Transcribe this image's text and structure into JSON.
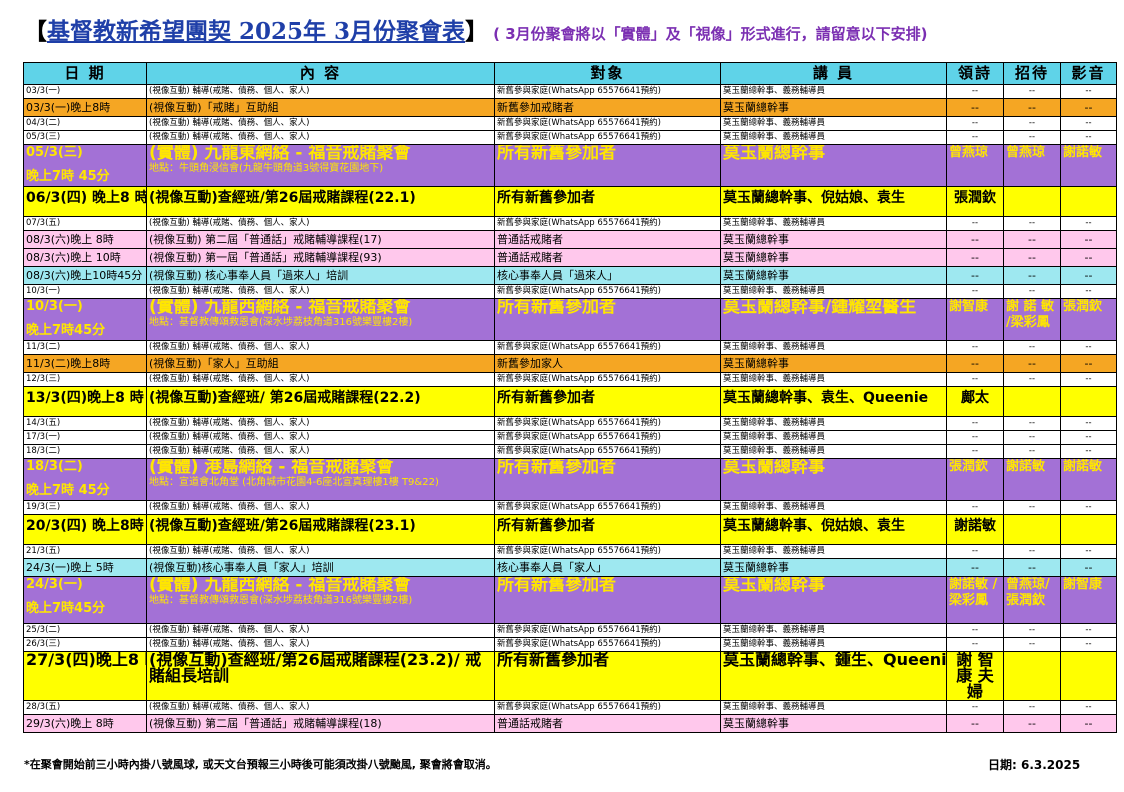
{
  "title": {
    "bracket_open": "【",
    "main": "基督教新希望團契 2025年 3月份聚會表",
    "bracket_close": "】",
    "subtitle": "( 3月份聚會將以「實體」及「視像」形式進行，請留意以下安排)"
  },
  "headers": [
    "日 期",
    "內 容",
    "對象",
    "講 員",
    "領詩",
    "招待",
    "影音"
  ],
  "rows": [
    {
      "cls": "r-m bg-white",
      "date": "03/3(一)",
      "content": "(視像互動) 輔導(戒賭、債務、個人、家人)",
      "target": "新舊參與家庭(WhatsApp 65576641預約)",
      "speaker": "莫玉蘭總幹事、義務輔導員",
      "lead": "--",
      "usher": "--",
      "av": "--"
    },
    {
      "cls": "r-s bg-orange",
      "date": "03/3(一)晚上8時",
      "content": "(視像互動)「戒賭」互助組",
      "target": "新舊參加戒賭者",
      "speaker": "莫玉蘭總幹事",
      "lead": "--",
      "usher": "--",
      "av": "--"
    },
    {
      "cls": "r-m bg-white",
      "date": "04/3(二)",
      "content": "(視像互動) 輔導(戒賭、債務、個人、家人)",
      "target": "新舊參與家庭(WhatsApp 65576641預約)",
      "speaker": "莫玉蘭總幹事、義務輔導員",
      "lead": "--",
      "usher": "--",
      "av": "--"
    },
    {
      "cls": "r-m bg-white",
      "date": "05/3(三)",
      "content": "(視像互動) 輔導(戒賭、債務、個人、家人)",
      "target": "新舊參與家庭(WhatsApp 65576641預約)",
      "speaker": "莫玉蘭總幹事、義務輔導員",
      "lead": "--",
      "usher": "--",
      "av": "--"
    },
    {
      "cls": "r-xl bg-purple",
      "date": "05/3(三)",
      "date2": "晚上7時 45分",
      "content": "(實體) 九龍東網絡 - 福音戒賭聚會",
      "loc": "地點：牛頭角浸信會(九龍牛頭角道3號得寶花園地下)",
      "target": "所有新舊參加者",
      "speaker": "莫玉蘭總幹事",
      "lead": "曾燕琼",
      "usher": "曾燕琼",
      "av": "謝諾敏"
    },
    {
      "cls": "r-l bg-yellow",
      "date": "06/3(四) 晚上8 時",
      "content": "(視像互動)查經班/第26屆戒賭課程(22.1)",
      "target": "所有新舊參加者",
      "speaker": "莫玉蘭總幹事、倪姑娘、袁生",
      "lead": "張潤欽",
      "usher": "",
      "av": ""
    },
    {
      "cls": "r-m bg-white",
      "date": "07/3(五)",
      "content": "(視像互動) 輔導(戒賭、債務、個人、家人)",
      "target": "新舊參與家庭(WhatsApp 65576641預約)",
      "speaker": "莫玉蘭總幹事、義務輔導員",
      "lead": "--",
      "usher": "--",
      "av": "--"
    },
    {
      "cls": "r-s bg-pink",
      "date": "08/3(六)晚上 8時",
      "content": "(視像互動) 第二屆「普通話」戒賭輔導課程(17)",
      "target": "普通話戒賭者",
      "speaker": "莫玉蘭總幹事",
      "lead": "--",
      "usher": "--",
      "av": "--"
    },
    {
      "cls": "r-s bg-pink",
      "date": "08/3(六)晚上 10時",
      "content": "(視像互動) 第一屆「普通話」戒賭輔導課程(93)",
      "target": "普通話戒賭者",
      "speaker": "莫玉蘭總幹事",
      "lead": "--",
      "usher": "--",
      "av": "--"
    },
    {
      "cls": "r-s bg-cyan",
      "date": "08/3(六)晚上10時45分",
      "content": "(視像互動) 核心事奉人員「過來人」培訓",
      "target": "核心事奉人員「過來人」",
      "speaker": "莫玉蘭總幹事",
      "lead": "--",
      "usher": "--",
      "av": "--"
    },
    {
      "cls": "r-m bg-white",
      "date": "10/3(一)",
      "content": "(視像互動) 輔導(戒賭、債務、個人、家人)",
      "target": "新舊參與家庭(WhatsApp 65576641預約)",
      "speaker": "莫玉蘭總幹事、義務輔導員",
      "lead": "--",
      "usher": "--",
      "av": "--"
    },
    {
      "cls": "r-xl bg-purple",
      "date": "10/3(一)",
      "date2": "晚上7時45分",
      "content": "(實體) 九龍西網絡 - 福音戒賭聚會",
      "loc": "地點：基督教傳頌救恩會(深水埗荔枝角道316號樂豐樓2樓)",
      "target": "所有新舊參加者",
      "speaker": "莫玉蘭總幹事/鍾耀堃醫生",
      "lead": "謝智康",
      "usher": "謝 諾 敏 /梁彩鳳",
      "av": "張潤欽"
    },
    {
      "cls": "r-m bg-white",
      "date": "11/3(二)",
      "content": "(視像互動) 輔導(戒賭、債務、個人、家人)",
      "target": "新舊參與家庭(WhatsApp 65576641預約)",
      "speaker": "莫玉蘭總幹事、義務輔導員",
      "lead": "--",
      "usher": "--",
      "av": "--"
    },
    {
      "cls": "r-s bg-orange",
      "date": "11/3(二)晚上8時",
      "content": "(視像互動)「家人」互助組",
      "target": "新舊參加家人",
      "speaker": "莫玉蘭總幹事",
      "lead": "--",
      "usher": "--",
      "av": "--"
    },
    {
      "cls": "r-m bg-white",
      "date": "12/3(三)",
      "content": "(視像互動) 輔導(戒賭、債務、個人、家人)",
      "target": "新舊參與家庭(WhatsApp 65576641預約)",
      "speaker": "莫玉蘭總幹事、義務輔導員",
      "lead": "--",
      "usher": "--",
      "av": "--"
    },
    {
      "cls": "r-l bg-yellow",
      "date": "13/3(四)晚上8 時",
      "content": "(視像互動)查經班/ 第26屆戒賭課程(22.2)",
      "target": "所有新舊參加者",
      "speaker": "莫玉蘭總幹事、袁生、Queenie",
      "lead": "鄺太",
      "usher": "",
      "av": ""
    },
    {
      "cls": "r-m bg-white",
      "date": "14/3(五)",
      "content": "(視像互動) 輔導(戒賭、債務、個人、家人)",
      "target": "新舊參與家庭(WhatsApp 65576641預約)",
      "speaker": "莫玉蘭總幹事、義務輔導員",
      "lead": "--",
      "usher": "--",
      "av": "--"
    },
    {
      "cls": "r-m bg-white",
      "date": "17/3(一)",
      "content": "(視像互動) 輔導(戒賭、債務、個人、家人)",
      "target": "新舊參與家庭(WhatsApp 65576641預約)",
      "speaker": "莫玉蘭總幹事、義務輔導員",
      "lead": "--",
      "usher": "--",
      "av": "--"
    },
    {
      "cls": "r-m bg-white",
      "date": "18/3(二)",
      "content": "(視像互動) 輔導(戒賭、債務、個人、家人)",
      "target": "新舊參與家庭(WhatsApp 65576641預約)",
      "speaker": "莫玉蘭總幹事、義務輔導員",
      "lead": "--",
      "usher": "--",
      "av": "--"
    },
    {
      "cls": "r-xl bg-purple",
      "date": "18/3(二)",
      "date2": "晚上7時 45分",
      "content": "(實體) 港島網絡 - 福音戒賭聚會",
      "loc": "地點：宣道會北角堂 (北角城市花園4-6座北宣真理樓1樓 T9&22)",
      "target": "所有新舊參加者",
      "speaker": "莫玉蘭總幹事",
      "lead": "張潤欽",
      "usher": "謝諾敏",
      "av": "謝諾敏"
    },
    {
      "cls": "r-m bg-white",
      "date": "19/3(三)",
      "content": "(視像互動) 輔導(戒賭、債務、個人、家人)",
      "target": "新舊參與家庭(WhatsApp 65576641預約)",
      "speaker": "莫玉蘭總幹事、義務輔導員",
      "lead": "--",
      "usher": "--",
      "av": "--"
    },
    {
      "cls": "r-l bg-yellow",
      "date": "20/3(四) 晚上8時",
      "content": "(視像互動)查經班/第26屆戒賭課程(23.1)",
      "target": "所有新舊參加者",
      "speaker": "莫玉蘭總幹事、倪姑娘、袁生",
      "lead": "謝諾敏",
      "usher": "",
      "av": ""
    },
    {
      "cls": "r-m bg-white",
      "date": "21/3(五)",
      "content": "(視像互動) 輔導(戒賭、債務、個人、家人)",
      "target": "新舊參與家庭(WhatsApp 65576641預約)",
      "speaker": "莫玉蘭總幹事、義務輔導員",
      "lead": "--",
      "usher": "--",
      "av": "--"
    },
    {
      "cls": "r-s bg-cyan",
      "date": "24/3(一)晚上 5時",
      "content": "(視像互動)核心事奉人員「家人」培訓",
      "target": "核心事奉人員「家人」",
      "speaker": "莫玉蘭總幹事",
      "lead": "--",
      "usher": "--",
      "av": "--"
    },
    {
      "cls": "r-xl2 bg-purple",
      "date": "24/3(一)",
      "date2": "晚上7時45分",
      "content": "(實體) 九龍西網絡 - 福音戒賭聚會",
      "loc": "地點：基督教傳頌救恩會(深水埗荔枝角道316號樂豐樓2樓)",
      "target": "所有新舊參加者",
      "speaker": "莫玉蘭總幹事",
      "lead": "謝諾敏 /梁彩鳳",
      "usher": "曾燕琼/ 張潤欽",
      "av": "謝智康"
    },
    {
      "cls": "r-m bg-white",
      "date": "25/3(二)",
      "content": "(視像互動) 輔導(戒賭、債務、個人、家人)",
      "target": "新舊參與家庭(WhatsApp 65576641預約)",
      "speaker": "莫玉蘭總幹事、義務輔導員",
      "lead": "--",
      "usher": "--",
      "av": "--"
    },
    {
      "cls": "r-m bg-white",
      "date": "26/3(三)",
      "content": "(視像互動) 輔導(戒賭、債務、個人、家人)",
      "target": "新舊參與家庭(WhatsApp 65576641預約)",
      "speaker": "莫玉蘭總幹事、義務輔導員",
      "lead": "--",
      "usher": "--",
      "av": "--"
    },
    {
      "cls": "r-xl bg-yellow",
      "date": "27/3(四)晚上8 時",
      "content": "(視像互動)查經班/第26屆戒賭課程(23.2)/ 戒賭組長培訓",
      "target": "所有新舊參加者",
      "speaker": "莫玉蘭總幹事、鍾生、Queenie",
      "lead": "謝 智 康 夫婦",
      "usher": "",
      "av": ""
    },
    {
      "cls": "r-m bg-white",
      "date": "28/3(五)",
      "content": "(視像互動) 輔導(戒賭、債務、個人、家人)",
      "target": "新舊參與家庭(WhatsApp 65576641預約)",
      "speaker": "莫玉蘭總幹事、義務輔導員",
      "lead": "--",
      "usher": "--",
      "av": "--"
    },
    {
      "cls": "r-s bg-pink",
      "date": "29/3(六)晚上 8時",
      "content": "(視像互動) 第二屆「普通話」戒賭輔導課程(18)",
      "target": "普通話戒賭者",
      "speaker": "莫玉蘭總幹事",
      "lead": "--",
      "usher": "--",
      "av": "--"
    }
  ],
  "footer": {
    "note": "*在聚會開始前三小時內掛八號風球, 或天文台預報三小時後可能須改掛八號颱風, 聚會將會取消。",
    "date": "日期: 6.3.2025"
  },
  "colors": {
    "header": "#5fd3e8",
    "orange": "#f5a623",
    "purple": "#a371d6",
    "yellow": "#ffff00",
    "pink": "#ffc8ec",
    "cyan": "#9ee8f0",
    "title_blue": "#1f3fa8"
  }
}
